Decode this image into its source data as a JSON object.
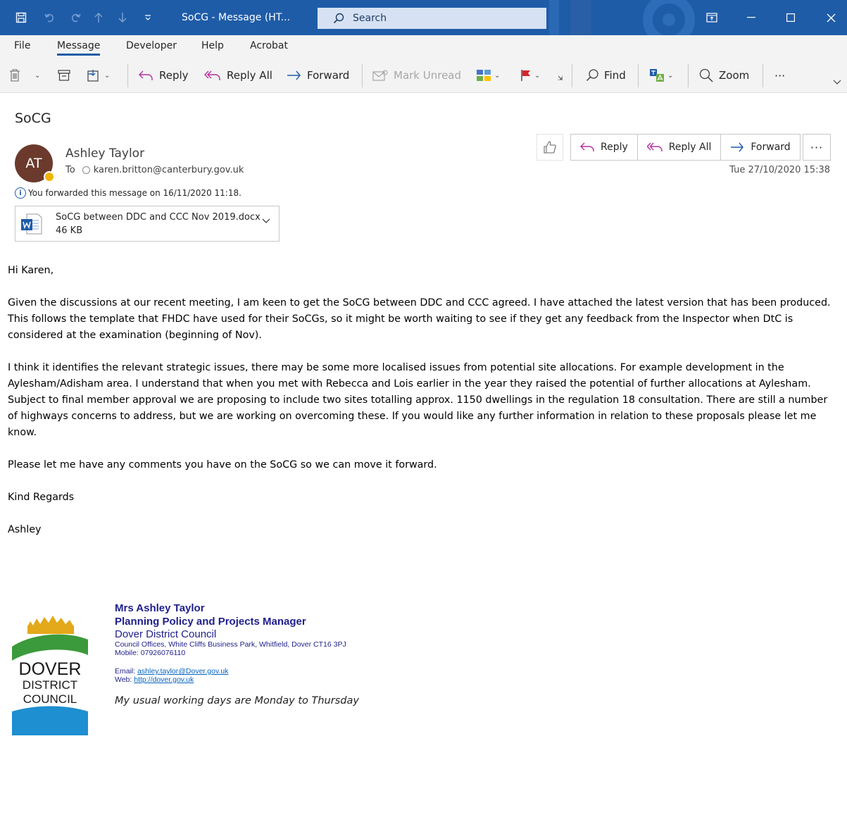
{
  "window": {
    "title": "SoCG  -  Message (HT...",
    "search_placeholder": "Search"
  },
  "ribbon": {
    "tabs": [
      "File",
      "Message",
      "Developer",
      "Help",
      "Acrobat"
    ],
    "active_tab": "Message",
    "toolbar": {
      "reply": "Reply",
      "reply_all": "Reply All",
      "forward": "Forward",
      "mark_unread": "Mark Unread",
      "find": "Find",
      "zoom": "Zoom",
      "more": "···"
    }
  },
  "message": {
    "subject": "SoCG",
    "sender_initials": "AT",
    "sender_name": "Ashley Taylor",
    "to_label": "To",
    "to_address": "karen.britton@canterbury.gov.uk",
    "forward_info": "You forwarded this message on 16/11/2020 11:18.",
    "date": "Tue 27/10/2020 15:38",
    "actions": {
      "reply": "Reply",
      "reply_all": "Reply All",
      "forward": "Forward",
      "more": "···"
    },
    "attachment": {
      "name": "SoCG between DDC and CCC Nov 2019.docx",
      "size": "46 KB"
    },
    "body": [
      "Hi Karen,",
      "Given the discussions at our recent meeting, I am keen to get the SoCG between DDC and CCC agreed. I have attached the latest version that has been produced. This follows the template that FHDC have used for their SoCGs, so it might be worth waiting to see if they get any feedback from the Inspector when DtC is considered at the examination (beginning of Nov).",
      "I think it identifies the relevant strategic issues, there may be some more localised issues from potential site allocations. For example development in the Aylesham/Adisham area. I understand that when you met with Rebecca and Lois earlier in the year they raised the potential of further allocations at Aylesham. Subject to final member approval we are proposing to include two sites totalling approx. 1150 dwellings in the regulation 18 consultation. There are still a number of highways concerns to address, but we are working on overcoming these. If you would like any further information in relation to these proposals please let me know.",
      "Please let me have any comments you have on the SoCG so we can move it forward.",
      "Kind Regards",
      "Ashley"
    ],
    "signature": {
      "name": "Mrs Ashley Taylor",
      "role": "Planning Policy and Projects Manager",
      "org": "Dover District Council",
      "address": "Council Offices, White Cliffs Business Park, Whitfield, Dover CT16 3PJ",
      "mobile": "Mobile: 07926076110",
      "email_label": "Email: ",
      "email": "ashley.taylor@Dover.gov.uk",
      "web_label": "Web: ",
      "web": "http://dover.gov.uk",
      "working_days": "My usual working days are Monday to Thursday",
      "logo_text": [
        "DOVER",
        "DISTRICT",
        "COUNCIL"
      ]
    }
  },
  "colors": {
    "titlebar": "#1f5ca8",
    "ribbon": "#f3f3f3",
    "avatar": "#6b3a2c",
    "signature": "#1f1f8a",
    "link": "#0563c1"
  }
}
